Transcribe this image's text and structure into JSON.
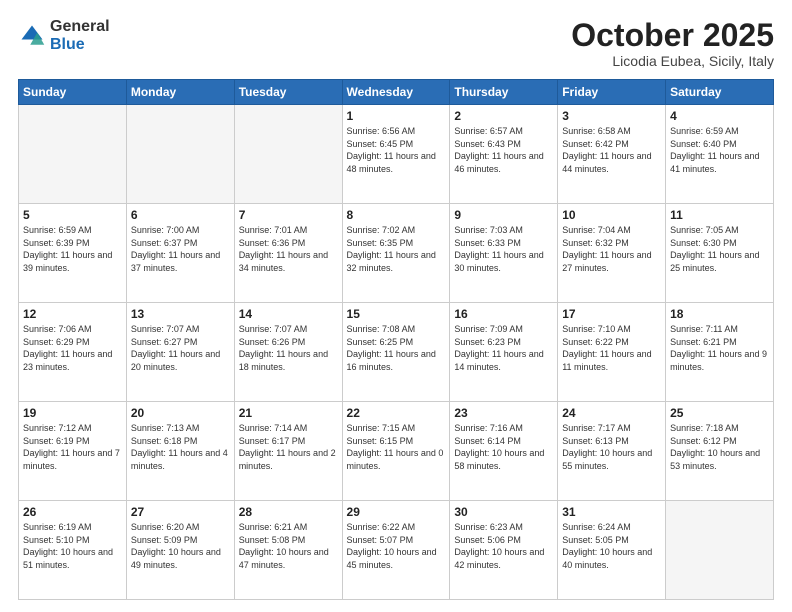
{
  "logo": {
    "general": "General",
    "blue": "Blue"
  },
  "header": {
    "month": "October 2025",
    "location": "Licodia Eubea, Sicily, Italy"
  },
  "days": [
    "Sunday",
    "Monday",
    "Tuesday",
    "Wednesday",
    "Thursday",
    "Friday",
    "Saturday"
  ],
  "weeks": [
    [
      {
        "day": "",
        "info": ""
      },
      {
        "day": "",
        "info": ""
      },
      {
        "day": "",
        "info": ""
      },
      {
        "day": "1",
        "info": "Sunrise: 6:56 AM\nSunset: 6:45 PM\nDaylight: 11 hours\nand 48 minutes."
      },
      {
        "day": "2",
        "info": "Sunrise: 6:57 AM\nSunset: 6:43 PM\nDaylight: 11 hours\nand 46 minutes."
      },
      {
        "day": "3",
        "info": "Sunrise: 6:58 AM\nSunset: 6:42 PM\nDaylight: 11 hours\nand 44 minutes."
      },
      {
        "day": "4",
        "info": "Sunrise: 6:59 AM\nSunset: 6:40 PM\nDaylight: 11 hours\nand 41 minutes."
      }
    ],
    [
      {
        "day": "5",
        "info": "Sunrise: 6:59 AM\nSunset: 6:39 PM\nDaylight: 11 hours\nand 39 minutes."
      },
      {
        "day": "6",
        "info": "Sunrise: 7:00 AM\nSunset: 6:37 PM\nDaylight: 11 hours\nand 37 minutes."
      },
      {
        "day": "7",
        "info": "Sunrise: 7:01 AM\nSunset: 6:36 PM\nDaylight: 11 hours\nand 34 minutes."
      },
      {
        "day": "8",
        "info": "Sunrise: 7:02 AM\nSunset: 6:35 PM\nDaylight: 11 hours\nand 32 minutes."
      },
      {
        "day": "9",
        "info": "Sunrise: 7:03 AM\nSunset: 6:33 PM\nDaylight: 11 hours\nand 30 minutes."
      },
      {
        "day": "10",
        "info": "Sunrise: 7:04 AM\nSunset: 6:32 PM\nDaylight: 11 hours\nand 27 minutes."
      },
      {
        "day": "11",
        "info": "Sunrise: 7:05 AM\nSunset: 6:30 PM\nDaylight: 11 hours\nand 25 minutes."
      }
    ],
    [
      {
        "day": "12",
        "info": "Sunrise: 7:06 AM\nSunset: 6:29 PM\nDaylight: 11 hours\nand 23 minutes."
      },
      {
        "day": "13",
        "info": "Sunrise: 7:07 AM\nSunset: 6:27 PM\nDaylight: 11 hours\nand 20 minutes."
      },
      {
        "day": "14",
        "info": "Sunrise: 7:07 AM\nSunset: 6:26 PM\nDaylight: 11 hours\nand 18 minutes."
      },
      {
        "day": "15",
        "info": "Sunrise: 7:08 AM\nSunset: 6:25 PM\nDaylight: 11 hours\nand 16 minutes."
      },
      {
        "day": "16",
        "info": "Sunrise: 7:09 AM\nSunset: 6:23 PM\nDaylight: 11 hours\nand 14 minutes."
      },
      {
        "day": "17",
        "info": "Sunrise: 7:10 AM\nSunset: 6:22 PM\nDaylight: 11 hours\nand 11 minutes."
      },
      {
        "day": "18",
        "info": "Sunrise: 7:11 AM\nSunset: 6:21 PM\nDaylight: 11 hours\nand 9 minutes."
      }
    ],
    [
      {
        "day": "19",
        "info": "Sunrise: 7:12 AM\nSunset: 6:19 PM\nDaylight: 11 hours\nand 7 minutes."
      },
      {
        "day": "20",
        "info": "Sunrise: 7:13 AM\nSunset: 6:18 PM\nDaylight: 11 hours\nand 4 minutes."
      },
      {
        "day": "21",
        "info": "Sunrise: 7:14 AM\nSunset: 6:17 PM\nDaylight: 11 hours\nand 2 minutes."
      },
      {
        "day": "22",
        "info": "Sunrise: 7:15 AM\nSunset: 6:15 PM\nDaylight: 11 hours\nand 0 minutes."
      },
      {
        "day": "23",
        "info": "Sunrise: 7:16 AM\nSunset: 6:14 PM\nDaylight: 10 hours\nand 58 minutes."
      },
      {
        "day": "24",
        "info": "Sunrise: 7:17 AM\nSunset: 6:13 PM\nDaylight: 10 hours\nand 55 minutes."
      },
      {
        "day": "25",
        "info": "Sunrise: 7:18 AM\nSunset: 6:12 PM\nDaylight: 10 hours\nand 53 minutes."
      }
    ],
    [
      {
        "day": "26",
        "info": "Sunrise: 6:19 AM\nSunset: 5:10 PM\nDaylight: 10 hours\nand 51 minutes."
      },
      {
        "day": "27",
        "info": "Sunrise: 6:20 AM\nSunset: 5:09 PM\nDaylight: 10 hours\nand 49 minutes."
      },
      {
        "day": "28",
        "info": "Sunrise: 6:21 AM\nSunset: 5:08 PM\nDaylight: 10 hours\nand 47 minutes."
      },
      {
        "day": "29",
        "info": "Sunrise: 6:22 AM\nSunset: 5:07 PM\nDaylight: 10 hours\nand 45 minutes."
      },
      {
        "day": "30",
        "info": "Sunrise: 6:23 AM\nSunset: 5:06 PM\nDaylight: 10 hours\nand 42 minutes."
      },
      {
        "day": "31",
        "info": "Sunrise: 6:24 AM\nSunset: 5:05 PM\nDaylight: 10 hours\nand 40 minutes."
      },
      {
        "day": "",
        "info": ""
      }
    ]
  ]
}
